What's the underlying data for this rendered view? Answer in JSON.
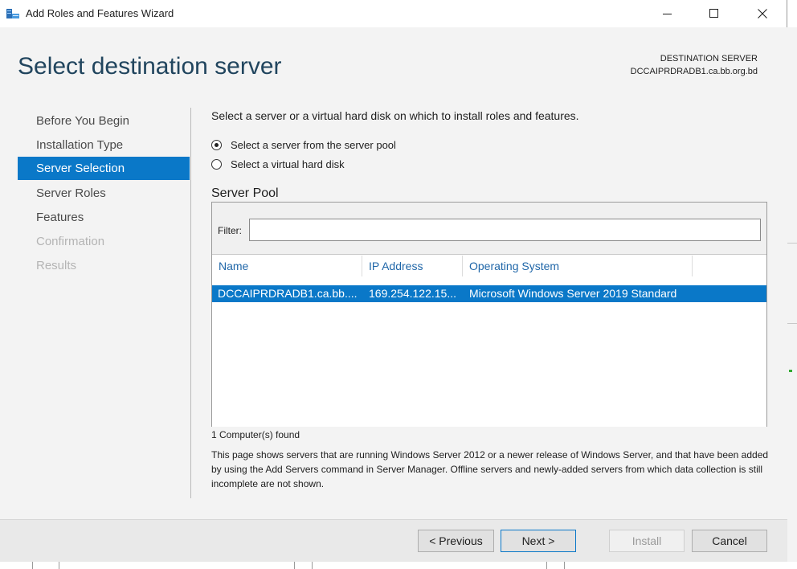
{
  "window": {
    "title": "Add Roles and Features Wizard",
    "icons": {
      "app": "server-manager-icon",
      "minimize": "minimize-icon",
      "maximize": "maximize-icon",
      "close": "close-icon"
    }
  },
  "header": {
    "page_title": "Select destination server",
    "destination_label": "DESTINATION SERVER",
    "destination_value": "DCCAIPRDRADB1.ca.bb.org.bd"
  },
  "nav": {
    "items": [
      {
        "label": "Before You Begin",
        "state": "normal"
      },
      {
        "label": "Installation Type",
        "state": "normal"
      },
      {
        "label": "Server Selection",
        "state": "active"
      },
      {
        "label": "Server Roles",
        "state": "normal"
      },
      {
        "label": "Features",
        "state": "normal"
      },
      {
        "label": "Confirmation",
        "state": "disabled"
      },
      {
        "label": "Results",
        "state": "disabled"
      }
    ]
  },
  "content": {
    "instruction": "Select a server or a virtual hard disk on which to install roles and features.",
    "radio_server_pool": {
      "label": "Select a server from the server pool",
      "checked": true
    },
    "radio_vhd": {
      "label": "Select a virtual hard disk",
      "checked": false
    },
    "pool_heading": "Server Pool",
    "filter_label": "Filter:",
    "filter_value": "",
    "columns": [
      "Name",
      "IP Address",
      "Operating System"
    ],
    "rows": [
      {
        "name": "DCCAIPRDRADB1.ca.bb....",
        "ip": "169.254.122.15...",
        "os": "Microsoft Windows Server 2019 Standard",
        "selected": true
      }
    ],
    "found_text": "1 Computer(s) found",
    "description": "This page shows servers that are running Windows Server 2012 or a newer release of Windows Server, and that have been added by using the Add Servers command in Server Manager. Offline servers and newly-added servers from which data collection is still incomplete are not shown."
  },
  "footer": {
    "previous": "< Previous",
    "next": "Next >",
    "install": "Install",
    "cancel": "Cancel"
  },
  "colors": {
    "accent": "#0a78c8",
    "title": "#21455e",
    "header_link": "#1f66a8"
  }
}
